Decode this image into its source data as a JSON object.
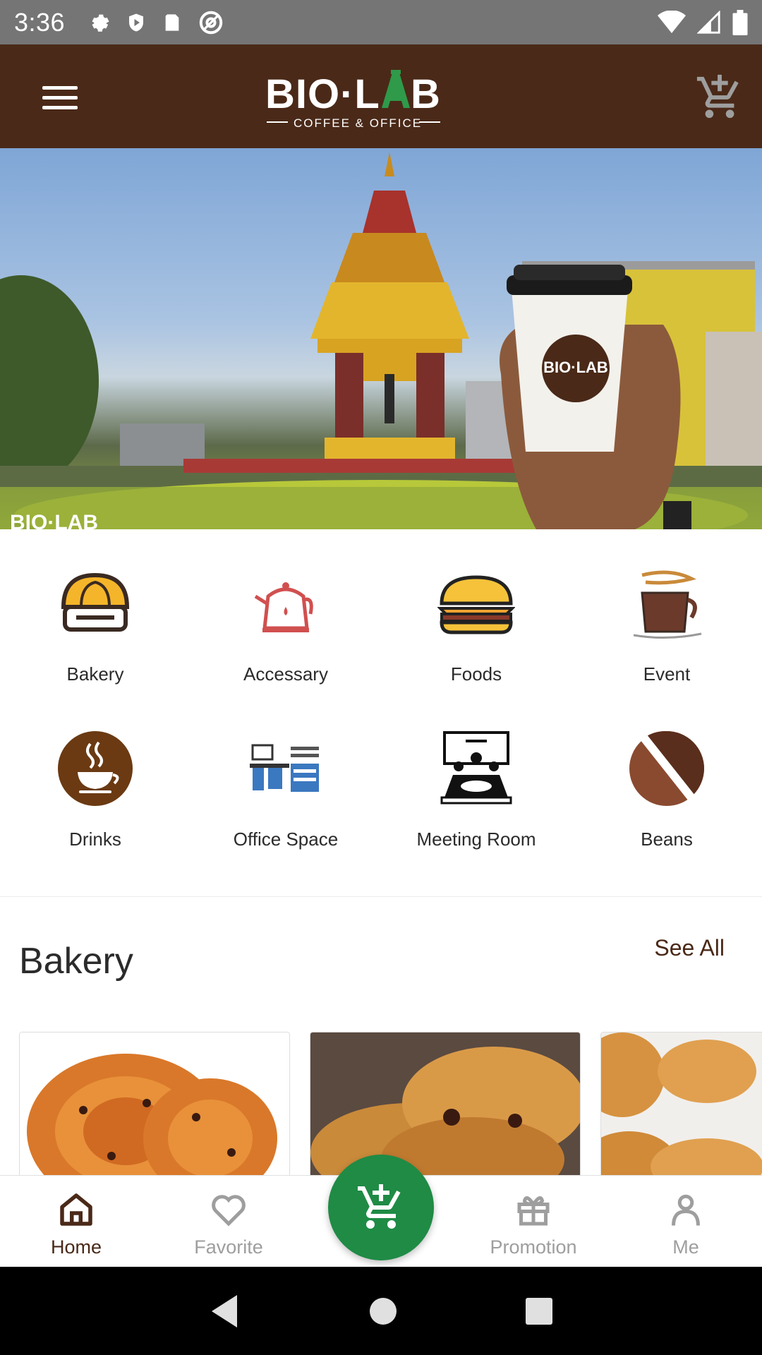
{
  "status_bar": {
    "time": "3:36"
  },
  "header": {
    "logo_text": "BIO·LAB",
    "logo_sub": "COFFEE & OFFICE"
  },
  "hero": {
    "watermark": "BIO·LAB"
  },
  "categories": [
    {
      "label": "Bakery",
      "icon": "bakery-icon"
    },
    {
      "label": "Accessary",
      "icon": "kettle-icon"
    },
    {
      "label": "Foods",
      "icon": "burger-icon"
    },
    {
      "label": "Event",
      "icon": "coffee-cup-icon"
    },
    {
      "label": "Drinks",
      "icon": "hot-drink-icon"
    },
    {
      "label": "Office Space",
      "icon": "office-icon"
    },
    {
      "label": "Meeting Room",
      "icon": "meeting-room-icon"
    },
    {
      "label": "Beans",
      "icon": "coffee-bean-icon"
    }
  ],
  "section": {
    "title": "Bakery",
    "see_all": "See All"
  },
  "bottom_nav": {
    "items": [
      {
        "label": "Home",
        "icon": "home-icon",
        "active": true
      },
      {
        "label": "Favorite",
        "icon": "heart-icon",
        "active": false
      },
      {
        "label": "",
        "icon": "cart-fab-icon",
        "active": false
      },
      {
        "label": "Promotion",
        "icon": "gift-icon",
        "active": false
      },
      {
        "label": "Me",
        "icon": "person-icon",
        "active": false
      }
    ]
  },
  "colors": {
    "brand_brown": "#4a2918",
    "accent_green": "#1f8b45",
    "status_gray": "#757575"
  }
}
